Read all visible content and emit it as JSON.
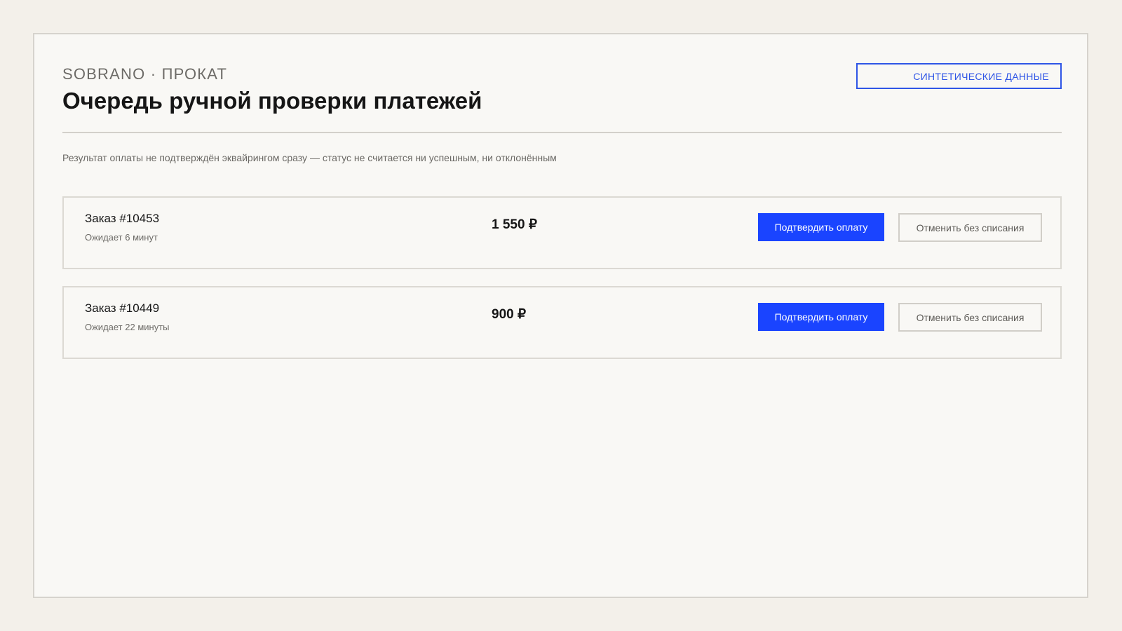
{
  "header": {
    "brand": "SOBRANO · ПРОКАТ",
    "title": "Очередь ручной проверки платежей",
    "badge": "СИНТЕТИЧЕСКИЕ ДАННЫЕ",
    "note": "Результат оплаты не подтверждён эквайрингом сразу — статус не считается ни успешным, ни отклонённым"
  },
  "orders": [
    {
      "title": "Заказ #10453",
      "wait": "Ожидает 6 минут",
      "amount": "1 550 ₽",
      "confirm_label": "Подтвердить оплату",
      "cancel_label": "Отменить без списания"
    },
    {
      "title": "Заказ #10449",
      "wait": "Ожидает 22 минуты",
      "amount": "900 ₽",
      "confirm_label": "Подтвердить оплату",
      "cancel_label": "Отменить без списания"
    }
  ],
  "colors": {
    "accent": "#1a44ff",
    "badge": "#2f55e6",
    "background": "#f3f0ea",
    "panel": "#f9f8f5"
  }
}
